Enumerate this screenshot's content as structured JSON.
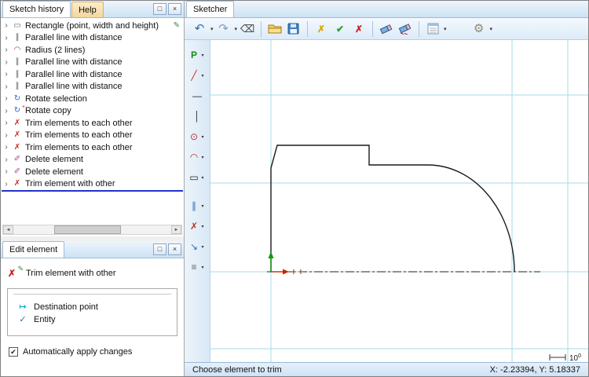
{
  "left_panel": {
    "tabs": {
      "history": "Sketch history",
      "help": "Help"
    },
    "history_items": [
      {
        "label": "Rectangle (point, width and height)"
      },
      {
        "label": "Parallel line with distance"
      },
      {
        "label": "Radius (2 lines)"
      },
      {
        "label": "Parallel line with distance"
      },
      {
        "label": "Parallel line with distance"
      },
      {
        "label": "Parallel line with distance"
      },
      {
        "label": "Rotate selection"
      },
      {
        "label": "Rotate copy"
      },
      {
        "label": "Trim elements to each other"
      },
      {
        "label": "Trim elements to each other"
      },
      {
        "label": "Trim elements to each other"
      },
      {
        "label": "Delete element"
      },
      {
        "label": "Delete element"
      },
      {
        "label": "Trim element with other",
        "selected": true
      }
    ]
  },
  "edit_panel": {
    "tab": "Edit element",
    "tool_label": "Trim element with other",
    "fields": {
      "destination": "Destination point",
      "entity": "Entity"
    },
    "auto_apply_label": "Automatically apply changes",
    "auto_apply_checked": true
  },
  "sketcher": {
    "tab": "Sketcher",
    "scale_base": "10",
    "scale_exp": "0"
  },
  "status_bar": {
    "message": "Choose element to trim",
    "coordinates": "X: -2.23394, Y: 5.18337"
  },
  "icons": {
    "expander": "›",
    "rectangle": "▭",
    "parallel": "∥",
    "radius": "◠",
    "rotate": "↻",
    "trim": "✗",
    "delete": "✐",
    "pencil": "✎",
    "plus": "+",
    "point": "P",
    "line": "╱",
    "hline": "—",
    "vline": "│",
    "circle": "⊙",
    "arc": "◠",
    "rect_tool": "▭",
    "offset": "∥",
    "arrow": "↘",
    "section": "≡",
    "undo": "↶",
    "redo": "↷",
    "backspace": "⌫",
    "cancel_yellow": "✗",
    "check": "✔",
    "cancel_red": "✗",
    "gear": "⚙",
    "caret": "▾",
    "restore": "□",
    "close": "×",
    "destination": "↦",
    "entity": "✓",
    "scroll_left": "◄",
    "scroll_right": "►"
  },
  "colors": {
    "accent": "#2a6fb8",
    "grid": "#a5dce6",
    "insert_indicator": "#2233cc",
    "axis_x": "#cc2200",
    "axis_y": "#119911"
  }
}
